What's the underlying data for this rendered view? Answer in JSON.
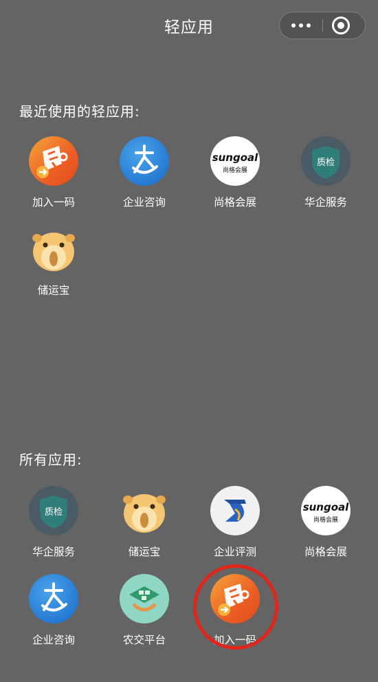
{
  "header": {
    "title": "轻应用"
  },
  "sections": {
    "recent": {
      "title": "最近使用的轻应用:"
    },
    "all": {
      "title": "所有应用:"
    }
  },
  "recent_apps": [
    {
      "label": "加入一码",
      "icon": "jiaruyima-logo-icon"
    },
    {
      "label": "企业咨询",
      "icon": "qiyezixun-logo-icon"
    },
    {
      "label": "尚格会展",
      "icon": "sungoal-logo-icon",
      "logo_text": "sungoal",
      "logo_subtext": "尚格会展"
    },
    {
      "label": "华企服务",
      "icon": "zhijian-shield-icon",
      "logo_text": "质检"
    },
    {
      "label": "储运宝",
      "icon": "hamster-icon"
    }
  ],
  "all_apps": [
    {
      "label": "华企服务",
      "icon": "zhijian-shield-icon",
      "logo_text": "质检"
    },
    {
      "label": "储运宝",
      "icon": "hamster-icon"
    },
    {
      "label": "企业评测",
      "icon": "qiyepingce-logo-icon"
    },
    {
      "label": "尚格会展",
      "icon": "sungoal-logo-icon",
      "logo_text": "sungoal",
      "logo_subtext": "尚格会展"
    },
    {
      "label": "企业咨询",
      "icon": "qiyezixun-logo-icon"
    },
    {
      "label": "农交平台",
      "icon": "nongjiao-logo-icon"
    },
    {
      "label": "加入一码",
      "icon": "jiaruyima-logo-icon",
      "highlighted": true
    }
  ],
  "colors": {
    "background": "#646464",
    "highlight_circle": "#e0261b",
    "text": "#ffffff"
  }
}
